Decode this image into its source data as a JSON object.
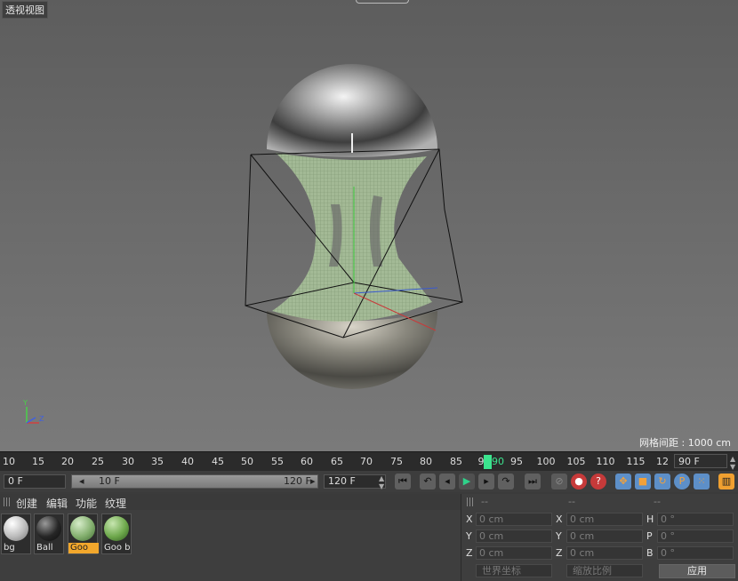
{
  "viewport": {
    "title": "透视视图",
    "grid_spacing_label": "网格间距 : 1000 cm"
  },
  "timeline": {
    "ticks": [
      "10",
      "15",
      "20",
      "25",
      "30",
      "35",
      "40",
      "45",
      "50",
      "55",
      "60",
      "65",
      "70",
      "75",
      "80",
      "85",
      "9",
      "95",
      "100",
      "105",
      "110",
      "115",
      "12"
    ],
    "current_frame_label": "90",
    "current_frame_value": "90 F"
  },
  "controls": {
    "start_frame": "0 F",
    "range_start": "10 F",
    "range_end": "120 F",
    "end_frame": "120 F"
  },
  "materials_panel": {
    "menu": [
      "创建",
      "编辑",
      "功能",
      "纹理"
    ],
    "materials": [
      {
        "name": "bg",
        "color": "#d8d8d8"
      },
      {
        "name": "Ball",
        "color": "#2a2a2a"
      },
      {
        "name": "Goo",
        "color": "#7fae6a",
        "selected": true
      },
      {
        "name": "Goo b",
        "color": "#6c9c4e"
      }
    ]
  },
  "coords_panel": {
    "headers": [
      "--",
      "--",
      "--"
    ],
    "rows": [
      {
        "a_label": "X",
        "a_value": "0 cm",
        "b_label": "X",
        "b_value": "0 cm",
        "c_label": "H",
        "c_value": "0 °"
      },
      {
        "a_label": "Y",
        "a_value": "0 cm",
        "b_label": "Y",
        "b_value": "0 cm",
        "c_label": "P",
        "c_value": "0 °"
      },
      {
        "a_label": "Z",
        "a_value": "0 cm",
        "b_label": "Z",
        "b_value": "0 cm",
        "c_label": "B",
        "c_value": "0 °"
      }
    ],
    "mode_dropdown": "世界坐标",
    "scale_dropdown": "缩放比例",
    "apply_label": "应用"
  }
}
